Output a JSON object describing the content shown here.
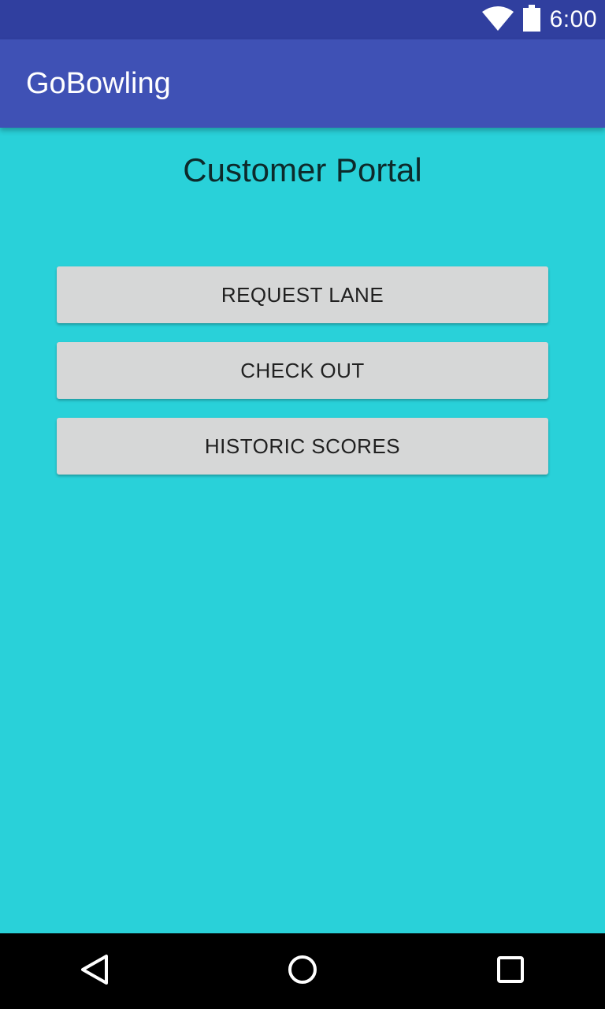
{
  "status_bar": {
    "time": "6:00",
    "icons": [
      "wifi-icon",
      "battery-icon"
    ]
  },
  "app_bar": {
    "title": "GoBowling"
  },
  "main": {
    "title": "Customer Portal",
    "buttons": [
      {
        "label": "REQUEST LANE"
      },
      {
        "label": "CHECK OUT"
      },
      {
        "label": "HISTORIC SCORES"
      }
    ]
  },
  "nav_bar": {
    "icons": [
      "back-icon",
      "home-icon",
      "recents-icon"
    ]
  },
  "colors": {
    "status_bar": "#303f9f",
    "app_bar": "#3f51b5",
    "background": "#29d1d9",
    "button": "#d6d7d7"
  }
}
